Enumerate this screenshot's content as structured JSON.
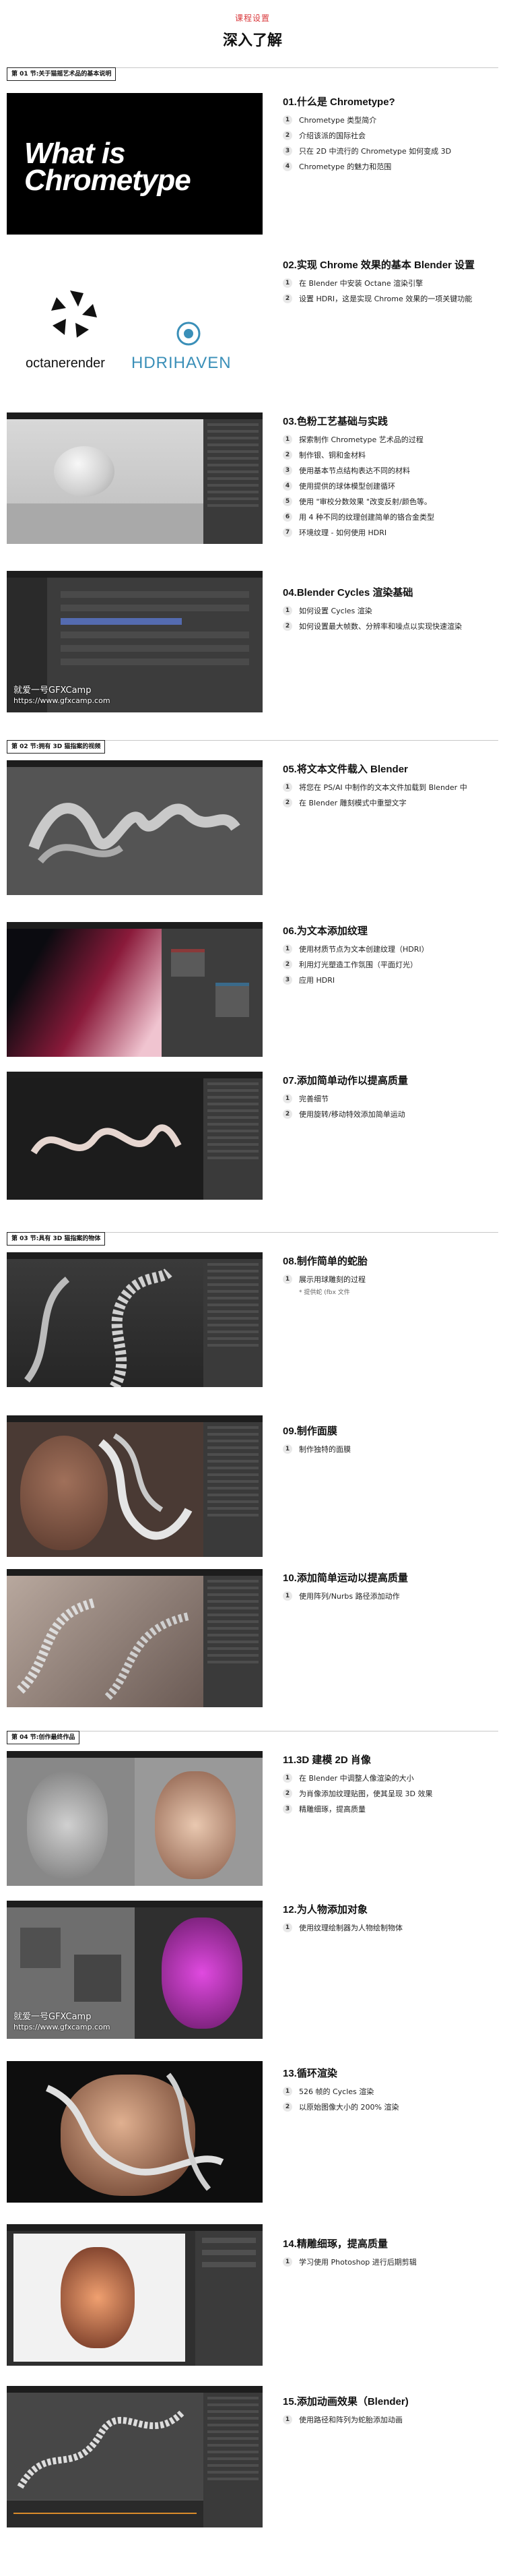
{
  "header": {
    "tag": "课程设置",
    "title": "深入了解"
  },
  "sections": [
    {
      "label": "第 01 节:关于猫摇艺术品的基本说明"
    },
    {
      "label": "第 02 节:拥有 3D 猫指案的视频"
    },
    {
      "label": "第 03 节:具有 3D 猫指案的物体"
    },
    {
      "label": "第 04 节:创作最终作品"
    }
  ],
  "banner": {
    "line1": "What is",
    "line2": "Chrometype"
  },
  "logos": {
    "octane": "octanerender",
    "hdri": "HDRIHAVEN"
  },
  "watermark": {
    "name": "就爱一号GFXCamp",
    "url": "https://www.gfxcamp.com"
  },
  "lessons": [
    {
      "title": "01.什么是 Chrometype?",
      "items": [
        "Chrometype 类型简介",
        "介绍该派的国际社会",
        "只在 2D 中流行的 Chrometype 如何变成 3D",
        "Chrometype 的魅力和范围"
      ]
    },
    {
      "title": "02.实现 Chrome 效果的基本 Blender 设置",
      "items": [
        "在 Blender 中安装 Octane 渲染引擎",
        "设置 HDRI，这是实现 Chrome 效果的一项关键功能"
      ]
    },
    {
      "title": "03.色粉工艺基础与实践",
      "items": [
        "探索制作 Chrometype 艺术品的过程",
        "制作银、铜和金材料",
        "使用基本节点结构表达不同的材料",
        "使用提供的球体模型创建循环",
        "使用 \"审校分数效果 \"改变反射/颜色等。",
        "用 4 种不同的纹理创建简单的铬合金类型",
        "环境纹理 - 如何使用 HDRI"
      ]
    },
    {
      "title": "04.Blender Cycles 渲染基础",
      "items": [
        "如何设置 Cycles 渲染",
        "如何设置最大帧数、分辨率和噪点以实现快速渲染"
      ]
    },
    {
      "title": "05.将文本文件载入 Blender",
      "items": [
        "将您在 PS/AI 中制作的文本文件加载到 Blender 中",
        "在 Blender 雕刻模式中重塑文字"
      ]
    },
    {
      "title": "06.为文本添加纹理",
      "items": [
        "使用材质节点为文本创建纹理（HDRI）",
        "利用灯光塑造工作氛围（平面灯光）",
        "应用 HDRI"
      ]
    },
    {
      "title": "07.添加简单动作以提高质量",
      "items": [
        "完善细节",
        "使用旋转/移动特效添加简单运动"
      ]
    },
    {
      "title": "08.制作简单的蛇胎",
      "items": [
        "展示用球雕刻的过程"
      ],
      "note": "* 提供蛇 (fbx 文件"
    },
    {
      "title": "09.制作面膜",
      "items": [
        "制作独特的面膜"
      ]
    },
    {
      "title": "10.添加简单运动以提高质量",
      "items": [
        "使用阵列/Nurbs 路径添加动作"
      ]
    },
    {
      "title": "11.3D 建模 2D 肖像",
      "items": [
        "在 Blender 中调整人像渲染的大小",
        "为肖像添加纹理贴图，使其呈现 3D 效果",
        "精雕细琢，提高质量"
      ]
    },
    {
      "title": "12.为人物添加对象",
      "items": [
        "使用纹理绘制器为人物绘制物体"
      ]
    },
    {
      "title": "13.循环渲染",
      "items": [
        "526 帧的 Cycles 渲染",
        "以原始图像大小的 200% 渲染"
      ]
    },
    {
      "title": "14.精雕细琢，提高质量",
      "items": [
        "学习使用 Photoshop 进行后期剪辑"
      ]
    },
    {
      "title": "15.添加动画效果（Blender)",
      "items": [
        "使用路径和阵列为蛇胎添加动画"
      ]
    }
  ]
}
